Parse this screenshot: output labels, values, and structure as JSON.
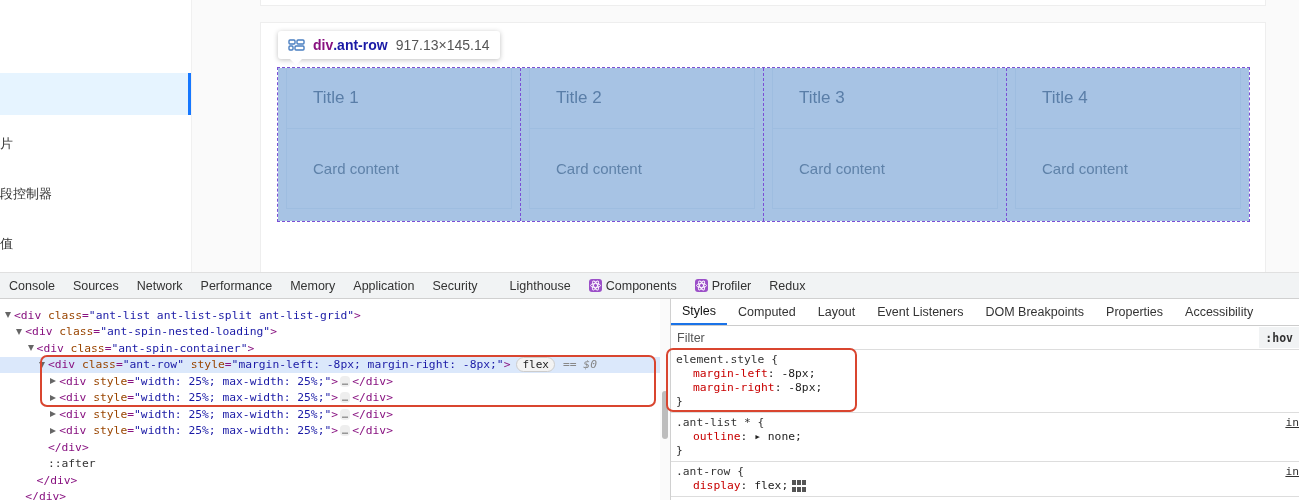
{
  "sidebar": {
    "items": [
      {
        "selected": true
      },
      {
        "label": "片",
        "selected": false
      },
      {
        "label": "段控制器",
        "selected": false
      },
      {
        "label": "值",
        "selected": false
      }
    ]
  },
  "tooltip": {
    "selector": "div.ant-row",
    "size": "917.13×145.14"
  },
  "cards": [
    {
      "title": "Title 1",
      "content": "Card content"
    },
    {
      "title": "Title 2",
      "content": "Card content"
    },
    {
      "title": "Title 3",
      "content": "Card content"
    },
    {
      "title": "Title 4",
      "content": "Card content"
    }
  ],
  "devtools": {
    "tabs": [
      {
        "label": "Console",
        "selected": false,
        "kind": "plain"
      },
      {
        "label": "Sources",
        "selected": false,
        "kind": "plain"
      },
      {
        "label": "Network",
        "selected": false,
        "kind": "plain"
      },
      {
        "label": "Performance",
        "selected": false,
        "kind": "plain"
      },
      {
        "label": "Memory",
        "selected": false,
        "kind": "plain"
      },
      {
        "label": "Application",
        "selected": false,
        "kind": "plain"
      },
      {
        "label": "Security",
        "selected": false,
        "kind": "plain"
      },
      {
        "label": "Lighthouse",
        "selected": false,
        "kind": "plain"
      },
      {
        "label": "Components",
        "selected": false,
        "kind": "extension"
      },
      {
        "label": "Profiler",
        "selected": false,
        "kind": "extension"
      },
      {
        "label": "Redux",
        "selected": false,
        "kind": "plain"
      }
    ],
    "dom_tree": [
      {
        "text": "<div class=\"ant-list ant-list-split ant-list-grid\">",
        "expanded": true,
        "selected": false,
        "children": [
          {
            "text": "<div class=\"ant-spin-nested-loading\">",
            "expanded": true,
            "selected": false,
            "close": "</div>",
            "children": [
              {
                "text": "<div class=\"ant-spin-container\">",
                "expanded": true,
                "selected": false,
                "close": "</div>",
                "children": [
                  {
                    "text": "<div class=\"ant-row\" style=\"margin-left: -8px; margin-right: -8px;\">",
                    "expanded": true,
                    "selected": true,
                    "badge": "flex",
                    "marker": "== $0",
                    "close": "</div>",
                    "children": [
                      {
                        "text": "<div style=\"width: 25%; max-width: 25%;\">",
                        "expanded": false,
                        "selected": false,
                        "ellipsis": "…",
                        "close": "</div>"
                      },
                      {
                        "text": "<div style=\"width: 25%; max-width: 25%;\">",
                        "expanded": false,
                        "selected": false,
                        "ellipsis": "…",
                        "close": "</div>"
                      },
                      {
                        "text": "<div style=\"width: 25%; max-width: 25%;\">",
                        "expanded": false,
                        "selected": false,
                        "ellipsis": "…",
                        "close": "</div>"
                      },
                      {
                        "text": "<div style=\"width: 25%; max-width: 25%;\">",
                        "expanded": false,
                        "selected": false,
                        "ellipsis": "…",
                        "close": "</div>"
                      }
                    ]
                  },
                  {
                    "text": "::after",
                    "kind": "pseudo"
                  }
                ]
              }
            ]
          }
        ]
      }
    ],
    "styles_tabs": [
      {
        "label": "Styles",
        "selected": true
      },
      {
        "label": "Computed",
        "selected": false
      },
      {
        "label": "Layout",
        "selected": false
      },
      {
        "label": "Event Listeners",
        "selected": false
      },
      {
        "label": "DOM Breakpoints",
        "selected": false
      },
      {
        "label": "Properties",
        "selected": false
      },
      {
        "label": "Accessibility",
        "selected": false
      }
    ],
    "filter": {
      "placeholder": "Filter",
      "hov": ":hov"
    },
    "rules": [
      {
        "selector": "element.style {",
        "declarations": [
          {
            "text": "margin-left: -8px;",
            "kind": "plain"
          },
          {
            "text": "margin-right: -8px;",
            "kind": "plain"
          }
        ],
        "close": "}"
      },
      {
        "selector": ".ant-list * {",
        "source": "in",
        "declarations": [
          {
            "text": "outline: ▸ none;",
            "kind": "plain"
          }
        ],
        "close": "}"
      },
      {
        "selector": ".ant-row {",
        "source": "in",
        "declarations": [
          {
            "text": "display: flex;",
            "kind": "flex-editor"
          }
        ]
      }
    ]
  }
}
